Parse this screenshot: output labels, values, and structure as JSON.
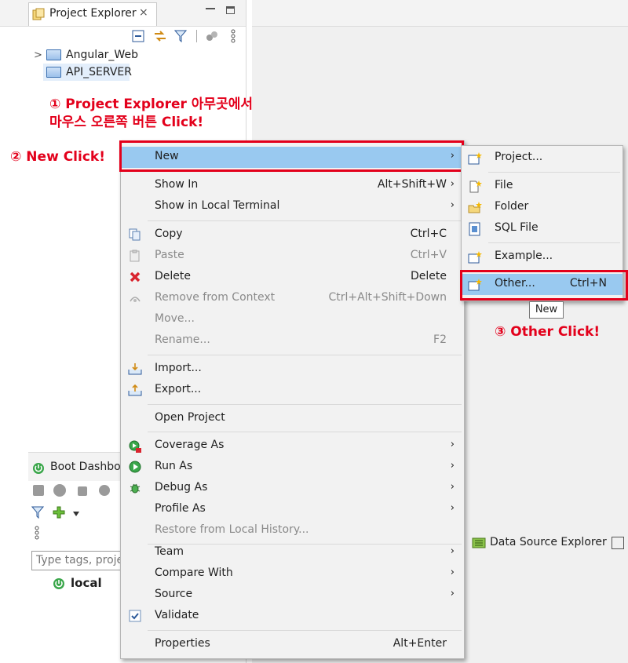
{
  "project_explorer": {
    "tab_label": "Project Explorer",
    "tab_close": "⨯",
    "projects": [
      {
        "name": "Angular_Web",
        "expander": ">"
      },
      {
        "name": "API_SERVER",
        "expander": ""
      }
    ]
  },
  "annotations": {
    "step1_line1": "① Project Explorer 아무곳에서",
    "step1_line2": "마우스 오른쪽 버튼 Click!",
    "step2": "② New Click!",
    "step3": "③ Other Click!"
  },
  "context_menu": {
    "items": [
      {
        "label": "New",
        "shortcut": "",
        "submenu": true,
        "disabled": false,
        "icon": ""
      },
      {
        "label": "Show In",
        "shortcut": "Alt+Shift+W",
        "submenu": true,
        "disabled": false,
        "icon": ""
      },
      {
        "label": "Show in Local Terminal",
        "shortcut": "",
        "submenu": true,
        "disabled": false,
        "icon": ""
      },
      {
        "label": "Copy",
        "shortcut": "Ctrl+C",
        "submenu": false,
        "disabled": false,
        "icon": "copy-icon"
      },
      {
        "label": "Paste",
        "shortcut": "Ctrl+V",
        "submenu": false,
        "disabled": true,
        "icon": "paste-icon"
      },
      {
        "label": "Delete",
        "shortcut": "Delete",
        "submenu": false,
        "disabled": false,
        "icon": "delete-icon"
      },
      {
        "label": "Remove from Context",
        "shortcut": "Ctrl+Alt+Shift+Down",
        "submenu": false,
        "disabled": true,
        "icon": "remove-context-icon"
      },
      {
        "label": "Move...",
        "shortcut": "",
        "submenu": false,
        "disabled": true,
        "icon": ""
      },
      {
        "label": "Rename...",
        "shortcut": "F2",
        "submenu": false,
        "disabled": true,
        "icon": ""
      },
      {
        "label": "Import...",
        "shortcut": "",
        "submenu": false,
        "disabled": false,
        "icon": "import-icon"
      },
      {
        "label": "Export...",
        "shortcut": "",
        "submenu": false,
        "disabled": false,
        "icon": "export-icon"
      },
      {
        "label": "Open Project",
        "shortcut": "",
        "submenu": false,
        "disabled": false,
        "icon": ""
      },
      {
        "label": "Coverage As",
        "shortcut": "",
        "submenu": true,
        "disabled": false,
        "icon": "coverage-icon"
      },
      {
        "label": "Run As",
        "shortcut": "",
        "submenu": true,
        "disabled": false,
        "icon": "run-icon"
      },
      {
        "label": "Debug As",
        "shortcut": "",
        "submenu": true,
        "disabled": false,
        "icon": "debug-icon"
      },
      {
        "label": "Profile As",
        "shortcut": "",
        "submenu": true,
        "disabled": false,
        "icon": ""
      },
      {
        "label": "Restore from Local History...",
        "shortcut": "",
        "submenu": false,
        "disabled": true,
        "icon": ""
      },
      {
        "label": "Team",
        "shortcut": "",
        "submenu": true,
        "disabled": false,
        "icon": ""
      },
      {
        "label": "Compare With",
        "shortcut": "",
        "submenu": true,
        "disabled": false,
        "icon": ""
      },
      {
        "label": "Source",
        "shortcut": "",
        "submenu": true,
        "disabled": false,
        "icon": ""
      },
      {
        "label": "Validate",
        "shortcut": "",
        "submenu": false,
        "disabled": false,
        "icon": "checkbox-icon"
      },
      {
        "label": "Properties",
        "shortcut": "Alt+Enter",
        "submenu": false,
        "disabled": false,
        "icon": ""
      }
    ],
    "arrow": "›"
  },
  "submenu_new": {
    "items": [
      {
        "label": "Project...",
        "shortcut": ""
      },
      {
        "label": "File",
        "shortcut": ""
      },
      {
        "label": "Folder",
        "shortcut": ""
      },
      {
        "label": "SQL File",
        "shortcut": ""
      },
      {
        "label": "Example...",
        "shortcut": ""
      },
      {
        "label": "Other...",
        "shortcut": "Ctrl+N"
      }
    ],
    "tooltip": "New"
  },
  "boot_dashboard": {
    "tab_label": "Boot Dashboa",
    "tag_placeholder": "Type tags, projec",
    "local_label": "local"
  },
  "data_source_explorer": {
    "tab_label": "Data Source Explorer"
  },
  "colors": {
    "annotation_red": "#e3001b",
    "menu_highlight": "#99c9f0",
    "menu_bg": "#f2f2f2"
  }
}
